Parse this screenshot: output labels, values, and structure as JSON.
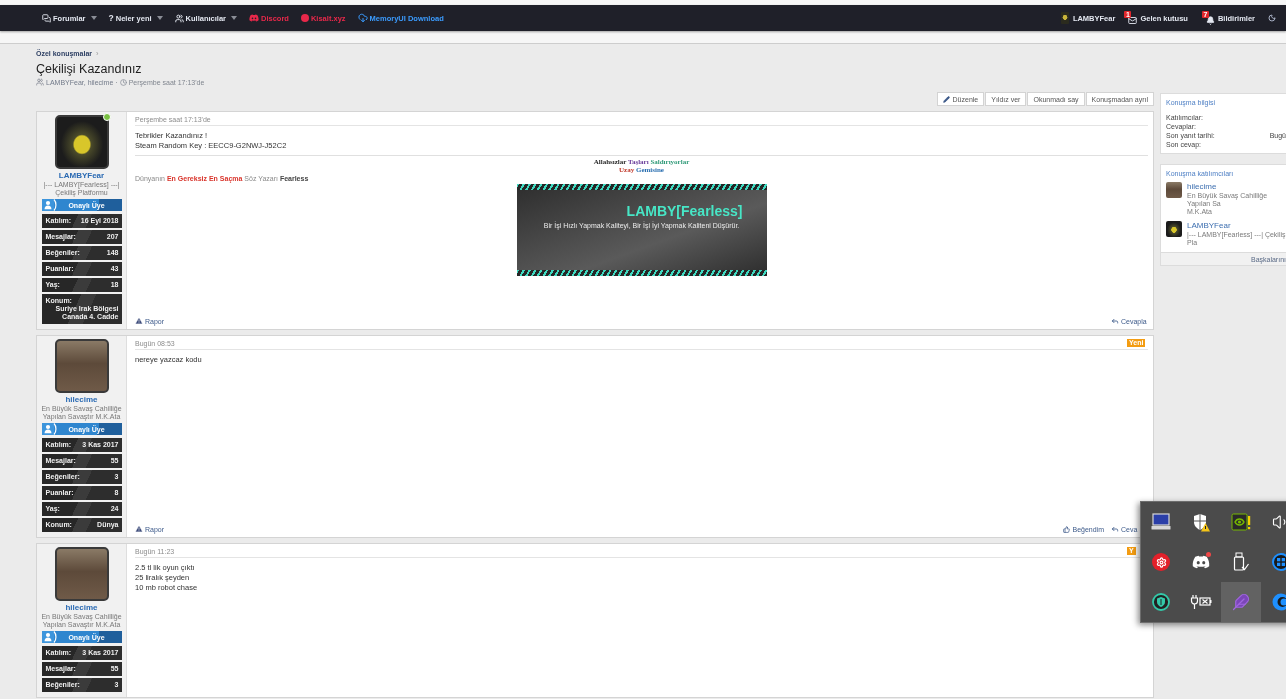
{
  "nav": {
    "items": [
      {
        "label": "Forumlar",
        "dropdown": true,
        "color": "#e4e8f1"
      },
      {
        "glyph": "?",
        "label": "Neler yeni",
        "dropdown": true,
        "color": "#e4e8f1"
      },
      {
        "label": "Kullanıcılar",
        "dropdown": true,
        "color": "#e4e8f1"
      },
      {
        "label": "Discord",
        "dropdown": false,
        "color": "#e8284a"
      },
      {
        "label": "Kisalt.xyz",
        "dropdown": false,
        "color": "#e8284a"
      },
      {
        "label": "MemoryUI Download",
        "dropdown": false,
        "color": "#3b9cff"
      }
    ],
    "account": {
      "username": "LAMBYFear"
    },
    "inbox": {
      "label": "Gelen kutusu",
      "count": "1"
    },
    "alerts": {
      "label": "Bildirimler",
      "count": "7"
    }
  },
  "breadcrumb": [
    {
      "label": "Özel konuşmalar",
      "separator": "›"
    }
  ],
  "conversation": {
    "title": "Çekilişi Kazandınız",
    "participants": "LAMBYFear, hilecime",
    "separator": "·",
    "started": "Perşembe saat 17:13'de"
  },
  "actions": [
    {
      "kind": "edit",
      "label": "Düzenle"
    },
    {
      "kind": "text",
      "label": "Yıldız ver"
    },
    {
      "kind": "text",
      "label": "Okunmadı say"
    },
    {
      "kind": "text",
      "label": "Konuşmadan ayrıl"
    }
  ],
  "posts": [
    {
      "author": {
        "name": "LAMBYFear",
        "avatar": {
          "kind": "mask"
        },
        "online": true,
        "title": "|--- LAMBY[Fearless] ---| Çekiliş Platformu",
        "role": "Onaylı Üye",
        "stats": [
          {
            "label": "Katılım:",
            "value": "16 Eyl 2018"
          },
          {
            "label": "Mesajlar:",
            "value": "207"
          },
          {
            "label": "Beğeniler:",
            "value": "148"
          },
          {
            "label": "Puanlar:",
            "value": "43"
          },
          {
            "label": "Yaş:",
            "value": "18"
          },
          {
            "label": "Konum:",
            "value": "Suriye Irak Bölgesi Canada 4. Cadde"
          }
        ]
      },
      "date": "Perşembe saat 17:13'de",
      "body": [
        "Tebrikler Kazandınız !",
        "Steam Random Key : EECC9-G2NWJ-J52C2"
      ],
      "signature": {
        "lines": [
          "Allahsızlar Taşları Saldırıyorlar",
          "Uzay Gemisine"
        ],
        "motto": "Dünyanın **En Gereksiz En Saçma** Söz Yazarı **Fearless**",
        "banner": {
          "title": "LAMBY[Fearless]",
          "tagline": "Bir İşi Hızlı Yapmak Kaliteyi, Bir İşi İyi Yapmak Kaliteni Düşürür."
        }
      },
      "footer": {
        "report": "Rapor",
        "reply": "Cevapla"
      }
    },
    {
      "author": {
        "name": "hilecime",
        "avatar": {
          "kind": "photo"
        },
        "online": false,
        "title": "En Büyük Savaş Cahilliğe Yapılan Savaştır M.K.Ata",
        "role": "Onaylı Üye",
        "stats": [
          {
            "label": "Katılım:",
            "value": "3 Kas 2017"
          },
          {
            "label": "Mesajlar:",
            "value": "55"
          },
          {
            "label": "Beğeniler:",
            "value": "3"
          },
          {
            "label": "Puanlar:",
            "value": "8"
          },
          {
            "label": "Yaş:",
            "value": "24"
          },
          {
            "label": "Konum:",
            "value": "Dünya"
          }
        ]
      },
      "date": "Bugün 08:53",
      "new_badge": "Yeni",
      "body": [
        "nereye yazcaz kodu"
      ],
      "footer": {
        "report": "Rapor",
        "like": "Beğendim",
        "reply": "Ceva"
      }
    },
    {
      "author": {
        "name": "hilecime",
        "avatar": {
          "kind": "photo"
        },
        "online": false,
        "title": "En Büyük Savaş Cahilliğe Yapılan Savaştır M.K.Ata",
        "role": "Onaylı Üye",
        "stats": [
          {
            "label": "Katılım:",
            "value": "3 Kas 2017"
          },
          {
            "label": "Mesajlar:",
            "value": "55"
          },
          {
            "label": "Beğeniler:",
            "value": "3"
          }
        ]
      },
      "date": "Bugün 11:23",
      "new_badge": "Y",
      "body": [
        "2.5 tl lik oyun çıktı",
        "25 liralık şeyden",
        "10 mb robot chase"
      ]
    }
  ],
  "sidebar": {
    "info": {
      "title": "Konuşma bilgisi",
      "rows": [
        {
          "label": "Katılımcılar:"
        },
        {
          "label": "Cevaplar:"
        },
        {
          "label": "Son yanıt tarihi:",
          "value": "Bugü"
        },
        {
          "label": "Son cevap:"
        }
      ]
    },
    "participants": {
      "title": "Konuşma katılımcıları",
      "people": [
        {
          "name": "hilecime",
          "avatar": {
            "kind": "photo"
          },
          "title_lines": [
            "En Büyük Savaş Cahilliğe Yapılan Sa",
            "M.K.Ata"
          ]
        },
        {
          "name": "LAMBYFear",
          "avatar": {
            "kind": "mask"
          },
          "title_lines": [
            "|--- LAMBY[Fearless] ---| Çekiliş Pla"
          ]
        }
      ],
      "more": "Başkalarını"
    }
  },
  "tray": {
    "items": [
      {
        "selected": false
      },
      {
        "selected": false
      },
      {
        "selected": false
      },
      {
        "selected": false
      },
      {
        "selected": false
      },
      {
        "selected": false
      },
      {
        "selected": false
      },
      {
        "selected": false
      },
      {
        "selected": false
      },
      {
        "selected": false
      },
      {
        "selected": true
      },
      {
        "selected": false
      }
    ]
  }
}
